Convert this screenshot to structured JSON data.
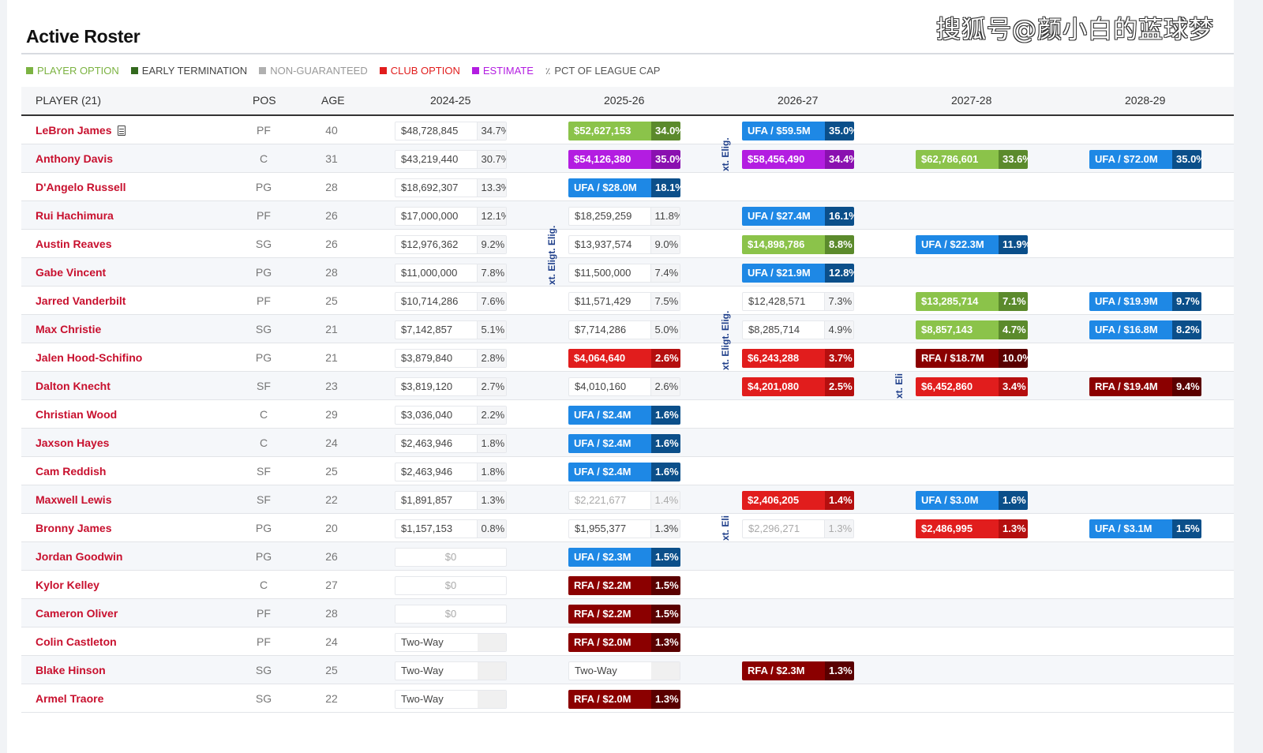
{
  "page": {
    "title": "Active Roster",
    "watermark": "搜狐号@颜小白的蓝球梦"
  },
  "legend": [
    {
      "label": "PLAYER OPTION",
      "color": "#7cb342",
      "text_color": "#7cb342"
    },
    {
      "label": "EARLY TERMINATION",
      "color": "#33691e",
      "text_color": "#444444"
    },
    {
      "label": "NON-GUARANTEED",
      "color": "#b0b0b0",
      "text_color": "#999999"
    },
    {
      "label": "CLUB OPTION",
      "color": "#e11d1d",
      "text_color": "#e11d1d"
    },
    {
      "label": "ESTIMATE",
      "color": "#b31de1",
      "text_color": "#b31de1"
    },
    {
      "label": "PCT OF LEAGUE CAP",
      "icon": "percent-icon",
      "text_color": "#555555"
    }
  ],
  "table": {
    "headers": [
      "PLAYER (21)",
      "POS",
      "AGE",
      "2024-25",
      "2025-26",
      "2026-27",
      "2027-28",
      "2028-29"
    ],
    "colors": {
      "ufa": [
        "#1e88e5",
        "#0b4f8a"
      ],
      "rfa": [
        "#8b0000",
        "#5a0000"
      ],
      "club": [
        "#e11d1d",
        "#b50f0f"
      ],
      "player": [
        "#8bc34a",
        "#5b8a2c"
      ],
      "estimate": [
        "#b31de1",
        "#8a10b0"
      ]
    },
    "elig_label": "xt. Eligt. Elig.",
    "rows": [
      {
        "name": "LeBron James",
        "doc": true,
        "pos": "PF",
        "age": "40",
        "cells": [
          {
            "t": "plain",
            "amt": "$48,728,845",
            "pct": "34.7%"
          },
          {
            "t": "player",
            "amt": "$52,627,153",
            "pct": "34.0%"
          },
          {
            "t": "ufa",
            "amt": "UFA / $59.5M",
            "pct": "35.0%"
          },
          null,
          null
        ]
      },
      {
        "name": "Anthony Davis",
        "pos": "C",
        "age": "31",
        "cells": [
          {
            "t": "plain",
            "amt": "$43,219,440",
            "pct": "30.7%"
          },
          {
            "t": "estimate",
            "amt": "$54,126,380",
            "pct": "35.0%"
          },
          {
            "t": "estimate",
            "amt": "$58,456,490",
            "pct": "34.4%"
          },
          {
            "t": "player",
            "amt": "$62,786,601",
            "pct": "33.6%"
          },
          {
            "t": "ufa",
            "amt": "UFA / $72.0M",
            "pct": "35.0%"
          }
        ]
      },
      {
        "name": "D'Angelo Russell",
        "pos": "PG",
        "age": "28",
        "cells": [
          {
            "t": "plain",
            "amt": "$18,692,307",
            "pct": "13.3%"
          },
          {
            "t": "ufa",
            "amt": "UFA / $28.0M",
            "pct": "18.1%"
          },
          null,
          null,
          null
        ]
      },
      {
        "name": "Rui Hachimura",
        "pos": "PF",
        "age": "26",
        "cells": [
          {
            "t": "plain",
            "amt": "$17,000,000",
            "pct": "12.1%"
          },
          {
            "t": "plain",
            "amt": "$18,259,259",
            "pct": "11.8%"
          },
          {
            "t": "ufa",
            "amt": "UFA / $27.4M",
            "pct": "16.1%"
          },
          null,
          null
        ]
      },
      {
        "name": "Austin Reaves",
        "pos": "SG",
        "age": "26",
        "cells": [
          {
            "t": "plain",
            "amt": "$12,976,362",
            "pct": "9.2%"
          },
          {
            "t": "plain",
            "amt": "$13,937,574",
            "pct": "9.0%"
          },
          {
            "t": "player",
            "amt": "$14,898,786",
            "pct": "8.8%"
          },
          {
            "t": "ufa",
            "amt": "UFA / $22.3M",
            "pct": "11.9%"
          },
          null
        ]
      },
      {
        "name": "Gabe Vincent",
        "pos": "PG",
        "age": "28",
        "cells": [
          {
            "t": "plain",
            "amt": "$11,000,000",
            "pct": "7.8%"
          },
          {
            "t": "plain",
            "amt": "$11,500,000",
            "pct": "7.4%"
          },
          {
            "t": "ufa",
            "amt": "UFA / $21.9M",
            "pct": "12.8%"
          },
          null,
          null
        ]
      },
      {
        "name": "Jarred Vanderbilt",
        "pos": "PF",
        "age": "25",
        "cells": [
          {
            "t": "plain",
            "amt": "$10,714,286",
            "pct": "7.6%"
          },
          {
            "t": "plain",
            "amt": "$11,571,429",
            "pct": "7.5%"
          },
          {
            "t": "plain",
            "amt": "$12,428,571",
            "pct": "7.3%"
          },
          {
            "t": "player",
            "amt": "$13,285,714",
            "pct": "7.1%"
          },
          {
            "t": "ufa",
            "amt": "UFA / $19.9M",
            "pct": "9.7%"
          }
        ]
      },
      {
        "name": "Max Christie",
        "pos": "SG",
        "age": "21",
        "cells": [
          {
            "t": "plain",
            "amt": "$7,142,857",
            "pct": "5.1%"
          },
          {
            "t": "plain",
            "amt": "$7,714,286",
            "pct": "5.0%"
          },
          {
            "t": "plain",
            "amt": "$8,285,714",
            "pct": "4.9%"
          },
          {
            "t": "player",
            "amt": "$8,857,143",
            "pct": "4.7%"
          },
          {
            "t": "ufa",
            "amt": "UFA / $16.8M",
            "pct": "8.2%"
          }
        ]
      },
      {
        "name": "Jalen Hood-Schifino",
        "pos": "PG",
        "age": "21",
        "cells": [
          {
            "t": "plain",
            "amt": "$3,879,840",
            "pct": "2.8%"
          },
          {
            "t": "club",
            "amt": "$4,064,640",
            "pct": "2.6%"
          },
          {
            "t": "club",
            "amt": "$6,243,288",
            "pct": "3.7%"
          },
          {
            "t": "rfa",
            "amt": "RFA / $18.7M",
            "pct": "10.0%"
          },
          null
        ]
      },
      {
        "name": "Dalton Knecht",
        "pos": "SF",
        "age": "23",
        "cells": [
          {
            "t": "plain",
            "amt": "$3,819,120",
            "pct": "2.7%"
          },
          {
            "t": "plain",
            "amt": "$4,010,160",
            "pct": "2.6%"
          },
          {
            "t": "club",
            "amt": "$4,201,080",
            "pct": "2.5%"
          },
          {
            "t": "club",
            "amt": "$6,452,860",
            "pct": "3.4%"
          },
          {
            "t": "rfa",
            "amt": "RFA / $19.4M",
            "pct": "9.4%"
          }
        ]
      },
      {
        "name": "Christian Wood",
        "pos": "C",
        "age": "29",
        "cells": [
          {
            "t": "plain",
            "amt": "$3,036,040",
            "pct": "2.2%"
          },
          {
            "t": "ufa",
            "amt": "UFA / $2.4M",
            "pct": "1.6%"
          },
          null,
          null,
          null
        ]
      },
      {
        "name": "Jaxson Hayes",
        "pos": "C",
        "age": "24",
        "cells": [
          {
            "t": "plain",
            "amt": "$2,463,946",
            "pct": "1.8%"
          },
          {
            "t": "ufa",
            "amt": "UFA / $2.4M",
            "pct": "1.6%"
          },
          null,
          null,
          null
        ]
      },
      {
        "name": "Cam Reddish",
        "pos": "SF",
        "age": "25",
        "cells": [
          {
            "t": "plain",
            "amt": "$2,463,946",
            "pct": "1.8%"
          },
          {
            "t": "ufa",
            "amt": "UFA / $2.4M",
            "pct": "1.6%"
          },
          null,
          null,
          null
        ]
      },
      {
        "name": "Maxwell Lewis",
        "pos": "SF",
        "age": "22",
        "cells": [
          {
            "t": "plain",
            "amt": "$1,891,857",
            "pct": "1.3%"
          },
          {
            "t": "faded",
            "amt": "$2,221,677",
            "pct": "1.4%"
          },
          {
            "t": "club",
            "amt": "$2,406,205",
            "pct": "1.4%"
          },
          {
            "t": "ufa",
            "amt": "UFA / $3.0M",
            "pct": "1.6%"
          },
          null
        ]
      },
      {
        "name": "Bronny James",
        "pos": "PG",
        "age": "20",
        "cells": [
          {
            "t": "plain",
            "amt": "$1,157,153",
            "pct": "0.8%"
          },
          {
            "t": "plain",
            "amt": "$1,955,377",
            "pct": "1.3%"
          },
          {
            "t": "faded",
            "amt": "$2,296,271",
            "pct": "1.3%"
          },
          {
            "t": "club",
            "amt": "$2,486,995",
            "pct": "1.3%"
          },
          {
            "t": "ufa",
            "amt": "UFA / $3.1M",
            "pct": "1.5%"
          }
        ]
      },
      {
        "name": "Jordan Goodwin",
        "pos": "PG",
        "age": "26",
        "cells": [
          {
            "t": "zero",
            "amt": "$0"
          },
          {
            "t": "ufa",
            "amt": "UFA / $2.3M",
            "pct": "1.5%"
          },
          null,
          null,
          null
        ]
      },
      {
        "name": "Kylor Kelley",
        "pos": "C",
        "age": "27",
        "cells": [
          {
            "t": "zero",
            "amt": "$0"
          },
          {
            "t": "rfa",
            "amt": "RFA / $2.2M",
            "pct": "1.5%"
          },
          null,
          null,
          null
        ]
      },
      {
        "name": "Cameron Oliver",
        "pos": "PF",
        "age": "28",
        "cells": [
          {
            "t": "zero",
            "amt": "$0"
          },
          {
            "t": "rfa",
            "amt": "RFA / $2.2M",
            "pct": "1.5%"
          },
          null,
          null,
          null
        ]
      },
      {
        "name": "Colin Castleton",
        "pos": "PF",
        "age": "24",
        "cells": [
          {
            "t": "twoway",
            "amt": "Two-Way"
          },
          {
            "t": "rfa",
            "amt": "RFA / $2.0M",
            "pct": "1.3%"
          },
          null,
          null,
          null
        ]
      },
      {
        "name": "Blake Hinson",
        "pos": "SG",
        "age": "25",
        "cells": [
          {
            "t": "twoway",
            "amt": "Two-Way"
          },
          {
            "t": "twoway",
            "amt": "Two-Way"
          },
          {
            "t": "rfa",
            "amt": "RFA / $2.3M",
            "pct": "1.3%"
          },
          null,
          null
        ]
      },
      {
        "name": "Armel Traore",
        "pos": "SG",
        "age": "22",
        "cells": [
          {
            "t": "twoway",
            "amt": "Two-Way"
          },
          {
            "t": "rfa",
            "amt": "RFA / $2.0M",
            "pct": "1.3%"
          },
          null,
          null,
          null
        ]
      }
    ],
    "elig_markers": [
      {
        "text": "xt. Eligt. Elig.",
        "col": 1,
        "row_start": 2,
        "row_end": 5
      },
      {
        "text": "xt. Elig.",
        "col": 2,
        "row_start": 0,
        "row_end": 1
      },
      {
        "text": "xt. Eligt. Elig.",
        "col": 2,
        "row_start": 6,
        "row_end": 8
      },
      {
        "text": "xt. Elig.",
        "col": 3,
        "row_start": 9,
        "row_end": 9
      },
      {
        "text": "xt. Elig.",
        "col": 2,
        "row_start": 14,
        "row_end": 14
      }
    ]
  }
}
